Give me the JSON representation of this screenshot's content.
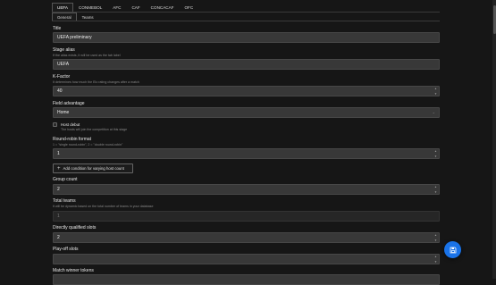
{
  "top_tabs": [
    "UEFA",
    "CONMEBOL",
    "AFC",
    "CAF",
    "CONCACAF",
    "OFC"
  ],
  "sub_tabs": [
    "General",
    "Teams"
  ],
  "form": {
    "title": {
      "label": "Title",
      "value": "UEFA preliminary"
    },
    "stage_alias": {
      "label": "Stage alias",
      "help": "If the alias exists, it will be used as the tab label",
      "value": "UEFA"
    },
    "k_factor": {
      "label": "K-Factor",
      "help": "It determines how much the Elo rating changes after a match",
      "value": "40"
    },
    "field_advantage": {
      "label": "Field advantage",
      "value": "Home"
    },
    "host_debut": {
      "label": "Host debut",
      "help": "The hosts will join the competition at this stage"
    },
    "round_robin": {
      "label": "Round-robin format",
      "help": "1 = \"single round-robin\", 2 = \"double round-robin\"",
      "value": "1"
    },
    "add_condition": {
      "label": "Add condition for varying host count"
    },
    "group_count": {
      "label": "Group count",
      "value": "2"
    },
    "total_teams": {
      "label": "Total teams",
      "help": "It will be dynamic based on the total number of teams in your database",
      "value": "1"
    },
    "directly_qualified": {
      "label": "Directly qualified slots",
      "value": "2"
    },
    "playoff_slots": {
      "label": "Play-off slots",
      "value": ""
    },
    "match_winner_tokens": {
      "label": "Match winner tokens",
      "value": ""
    }
  },
  "icons": {
    "fab": "save-icon",
    "add": "plus-icon"
  },
  "colors": {
    "fab": "#1a73e8",
    "background": "#161616",
    "field": "#383838"
  }
}
